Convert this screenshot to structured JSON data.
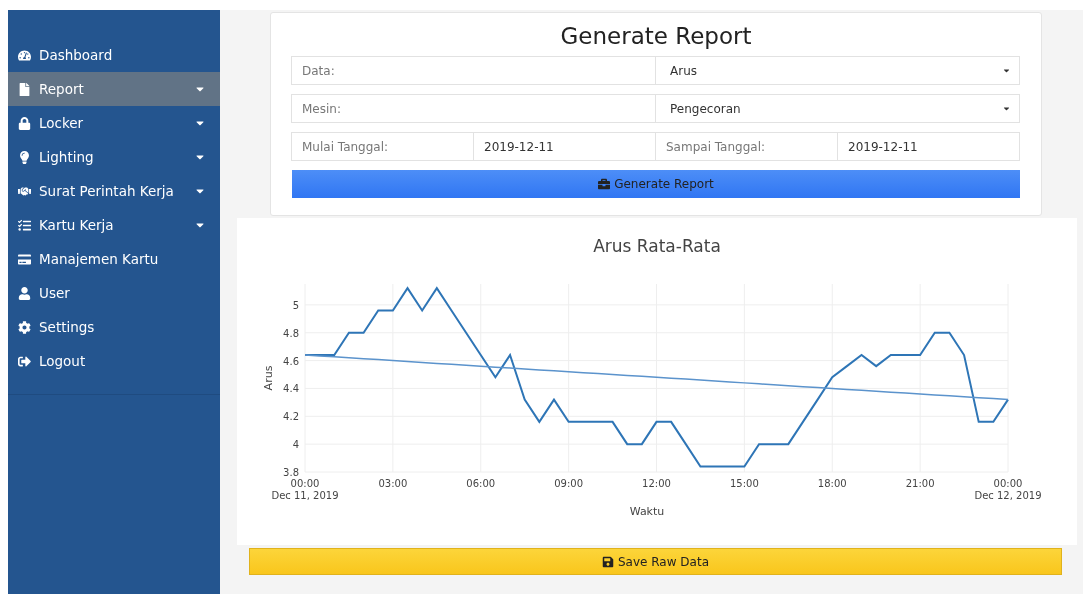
{
  "sidebar": {
    "items": [
      {
        "label": "Dashboard",
        "selected": false,
        "has_submenu": false
      },
      {
        "label": "Report",
        "selected": true,
        "has_submenu": true
      },
      {
        "label": "Locker",
        "selected": false,
        "has_submenu": true
      },
      {
        "label": "Lighting",
        "selected": false,
        "has_submenu": true
      },
      {
        "label": "Surat Perintah Kerja",
        "selected": false,
        "has_submenu": true
      },
      {
        "label": "Kartu Kerja",
        "selected": false,
        "has_submenu": true
      },
      {
        "label": "Manajemen Kartu",
        "selected": false,
        "has_submenu": false
      },
      {
        "label": "User",
        "selected": false,
        "has_submenu": false
      },
      {
        "label": "Settings",
        "selected": false,
        "has_submenu": false
      },
      {
        "label": "Logout",
        "selected": false,
        "has_submenu": false
      }
    ]
  },
  "report_form": {
    "title": "Generate Report",
    "rows": [
      {
        "kind": "select",
        "label": "Data:",
        "value": "Arus"
      },
      {
        "kind": "select",
        "label": "Mesin:",
        "value": "Pengecoran"
      },
      {
        "kind": "dates",
        "label": "Mulai Tanggal:",
        "value": "2019-12-11",
        "label_2": "Sampai Tanggal:",
        "value_2": "2019-12-11"
      }
    ],
    "button": "Generate Report"
  },
  "chart_panel": {
    "chart_data": {
      "type": "line",
      "title": "Arus Rata-Rata",
      "xlabel": "Waktu",
      "ylabel": "Arus",
      "x": [
        0,
        0.5,
        1,
        1.5,
        2,
        2.5,
        3,
        3.5,
        4,
        4.5,
        5,
        5.5,
        6,
        6.5,
        7,
        7.5,
        8,
        8.5,
        9,
        9.5,
        10,
        10.5,
        11,
        11.5,
        12,
        12.5,
        13,
        13.5,
        14,
        14.5,
        15,
        15.5,
        16,
        16.5,
        17,
        17.5,
        18,
        18.5,
        19,
        19.5,
        20,
        20.5,
        21,
        21.5,
        22,
        22.5,
        23,
        23.5,
        24
      ],
      "series": [
        {
          "color": "#2e75b6",
          "values": [
            4.64,
            4.64,
            4.64,
            4.8,
            4.8,
            4.96,
            4.96,
            5.12,
            4.96,
            5.12,
            4.96,
            4.8,
            4.64,
            4.48,
            4.64,
            4.32,
            4.16,
            4.32,
            4.16,
            4.16,
            4.16,
            4.16,
            4,
            4,
            4.16,
            4.16,
            4,
            3.84,
            3.84,
            3.84,
            3.84,
            4,
            4,
            4,
            4.16,
            4.32,
            4.48,
            4.56,
            4.64,
            4.56,
            4.64,
            4.64,
            4.64,
            4.8,
            4.8,
            4.64,
            4.16,
            4.16,
            4.32
          ]
        },
        {
          "color": "#5b93cc",
          "values": [
            4.64,
            4.633,
            4.627,
            4.62,
            4.613,
            4.607,
            4.6,
            4.593,
            4.587,
            4.58,
            4.573,
            4.567,
            4.56,
            4.553,
            4.547,
            4.54,
            4.533,
            4.527,
            4.52,
            4.513,
            4.507,
            4.5,
            4.493,
            4.487,
            4.48,
            4.473,
            4.467,
            4.46,
            4.453,
            4.447,
            4.44,
            4.433,
            4.427,
            4.42,
            4.413,
            4.407,
            4.4,
            4.393,
            4.387,
            4.38,
            4.373,
            4.367,
            4.36,
            4.353,
            4.347,
            4.34,
            4.333,
            4.327,
            4.32
          ]
        }
      ],
      "xlim": [
        0,
        24
      ],
      "ylim": [
        3.8,
        5.15
      ],
      "xticks": [
        {
          "value": 0,
          "label": "00:00"
        },
        {
          "value": 3,
          "label": "03:00"
        },
        {
          "value": 6,
          "label": "06:00"
        },
        {
          "value": 9,
          "label": "09:00"
        },
        {
          "value": 12,
          "label": "12:00"
        },
        {
          "value": 15,
          "label": "15:00"
        },
        {
          "value": 18,
          "label": "18:00"
        },
        {
          "value": 21,
          "label": "21:00"
        },
        {
          "value": 24,
          "label": "00:00"
        }
      ],
      "yticks": [
        3.8,
        {
          "value": 4,
          "label": "4"
        },
        4.2,
        4.4,
        4.6,
        4.8,
        {
          "value": 5,
          "label": "5"
        }
      ],
      "grid": true,
      "annotations": [
        "Dec 11, 2019",
        "Dec 12, 2019"
      ]
    },
    "button": "Save Raw Data"
  }
}
